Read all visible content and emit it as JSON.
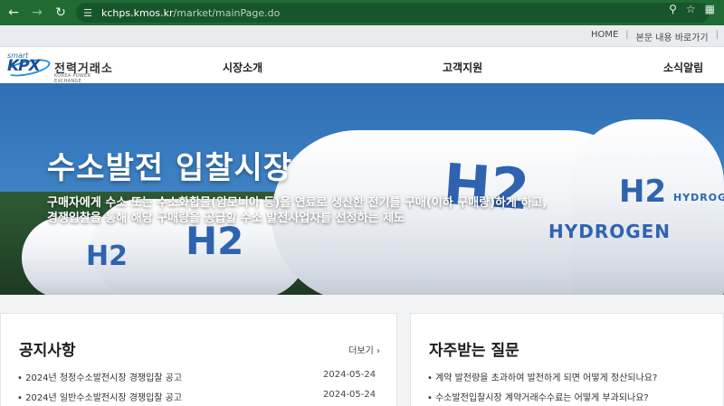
{
  "browser": {
    "url_host": "kchps.kmos.kr",
    "url_path": "/market/mainPage.do",
    "icons": [
      "back-icon",
      "forward-icon",
      "reload-icon",
      "site-info-icon",
      "zoom-icon",
      "star-icon",
      "extension-icon"
    ]
  },
  "util_links": [
    "HOME",
    "본문 내용 바로가기"
  ],
  "logo": {
    "smart": "smart",
    "kpx": "KPX",
    "name_kor": "전력거래소",
    "name_eng": "KOREA POWER EXCHANGE"
  },
  "gnb": [
    "시장소개",
    "고객지원",
    "소식알림"
  ],
  "hero": {
    "title": "수소발전 입찰시장",
    "desc_line1": "구매자에게 수소 또는 수소화합물(암모니아 등)을 연료로 생산한 전기를 구매(이하 구매량)하게 하고,",
    "desc_line2": "경쟁입찰을 통해 해당 구매량을 공급할 수소 발전사업자를 선정하는 제도",
    "tank_labels": [
      "H2",
      "H2",
      "H2",
      "HYDROGEN",
      "HYDROG"
    ]
  },
  "notice": {
    "title": "공지사항",
    "more": "더보기",
    "items": [
      {
        "title": "2024년 청정수소발전시장 경쟁입찰 공고",
        "date": "2024-05-24"
      },
      {
        "title": "2024년 일반수소발전시장 경쟁입찰 공고",
        "date": "2024-05-24"
      }
    ]
  },
  "faq": {
    "title": "자주받는 질문",
    "items": [
      "계약 발전량을 초과하여 발전하게 되면 어떻게 정산되나요?",
      "수소발전입찰시장 계약거래수수료는 어떻게 부과되나요?"
    ]
  },
  "colors": {
    "chrome_green": "#1f6b33",
    "brand_blue": "#1c4f99",
    "h2_blue": "#2f63b0"
  }
}
